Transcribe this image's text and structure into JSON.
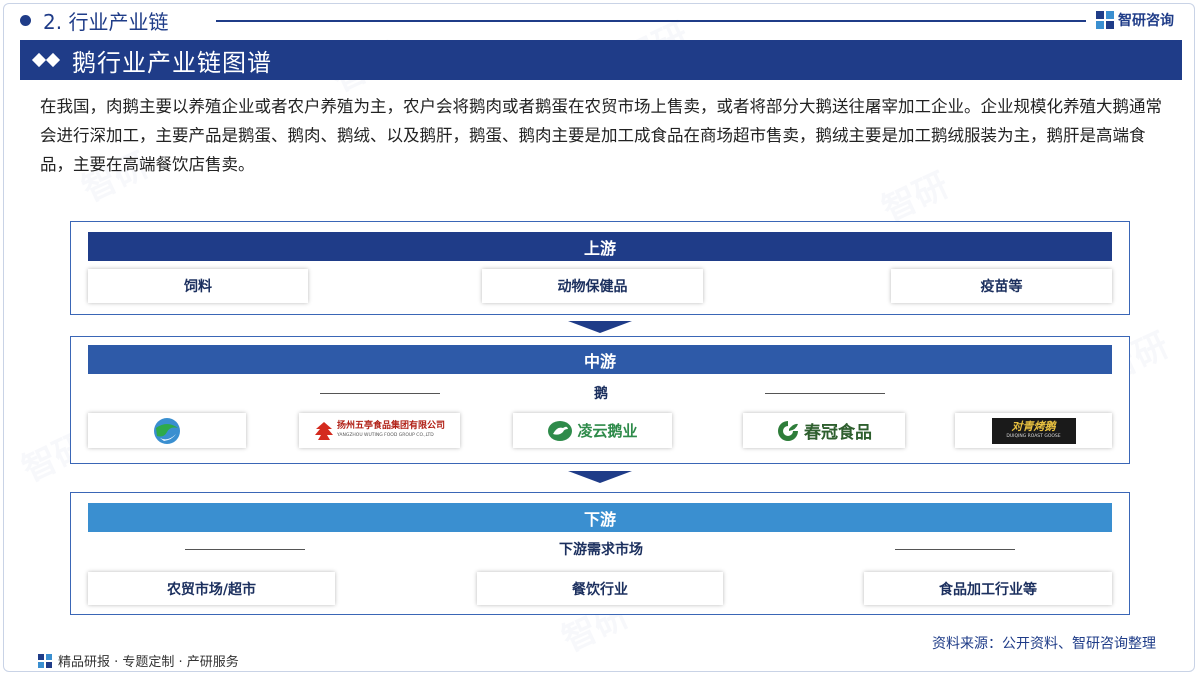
{
  "header": {
    "section_title": "2. 行业产业链",
    "brand_name": "智研咨询"
  },
  "banner": {
    "title": "鹅行业产业链图谱"
  },
  "description": "在我国，肉鹅主要以养殖企业或者农户养殖为主，农户会将鹅肉或者鹅蛋在农贸市场上售卖，或者将部分大鹅送往屠宰加工企业。企业规模化养殖大鹅通常会进行深加工，主要产品是鹅蛋、鹅肉、鹅绒、以及鹅肝，鹅蛋、鹅肉主要是加工成食品在商场超市售卖，鹅绒主要是加工鹅绒服装为主，鹅肝是高端食品，主要在高端餐饮店售卖。",
  "upstream": {
    "title": "上游",
    "items": [
      "饲料",
      "动物保健品",
      "疫苗等"
    ]
  },
  "midstream": {
    "title": "中游",
    "subtitle": "鹅",
    "companies": [
      {
        "name": "",
        "icon": "globe-logo-icon"
      },
      {
        "name": "扬州五亭食品集团有限公司",
        "en": "YANGZHOU WUTING FOOD GROUP CO.,LTD",
        "icon": "pagoda-logo-icon"
      },
      {
        "name": "凌云鹅业",
        "icon": "goose-logo-icon"
      },
      {
        "name": "春冠食品",
        "icon": "leaf-logo-icon"
      },
      {
        "name": "对青烤鹅",
        "en": "DUIQING ROAST GOOSE",
        "icon": "duiqing-logo-icon"
      }
    ]
  },
  "downstream": {
    "title": "下游",
    "subtitle": "下游需求市场",
    "items": [
      "农贸市场/超市",
      "餐饮行业",
      "食品加工行业等"
    ]
  },
  "footer": {
    "left_text": "精品研报 · 专题定制 · 产研服务",
    "source": "资料来源：公开资料、智研咨询整理"
  },
  "colors": {
    "navy": "#1f3c88",
    "upstream_header": "#1f3c88",
    "midstream_header": "#2e5aa8",
    "downstream_header": "#3a8fd0"
  }
}
